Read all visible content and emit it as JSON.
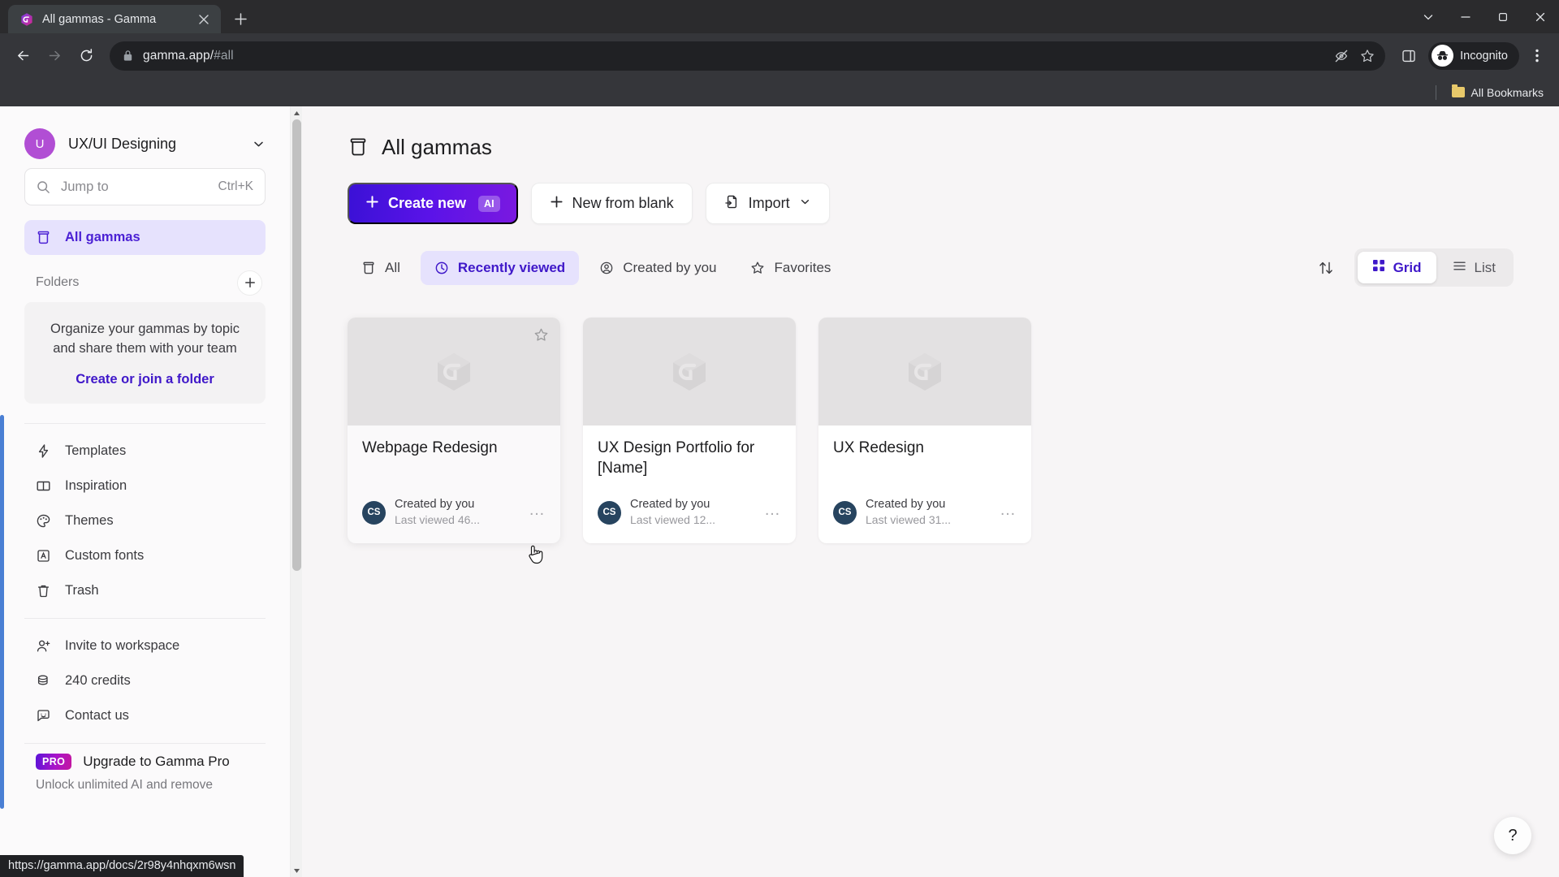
{
  "browser": {
    "tab": {
      "title": "All gammas - Gamma",
      "favicon": "gamma-logo-icon",
      "close": "×"
    },
    "newtab_label": "+",
    "window_controls": {
      "expand": "chevron-down-icon",
      "minimize": "minimize-icon",
      "maximize": "restore-icon",
      "close": "close-icon"
    },
    "nav": {
      "back": "back-arrow-icon",
      "forward": "forward-arrow-icon",
      "reload": "reload-icon"
    },
    "omnibox": {
      "lock": "lock-icon",
      "url_main": "gamma.app/",
      "url_fragment": "#all",
      "tracking": "eye-off-icon",
      "bookmark": "star-icon"
    },
    "side_panel": "side-panel-icon",
    "profile": {
      "label": "Incognito",
      "icon": "incognito-icon"
    },
    "menu": "three-dots-menu-icon",
    "bookmarks": {
      "label": "All Bookmarks",
      "icon": "folder-icon"
    },
    "status_url": "https://gamma.app/docs/2r98y4nhqxm6wsn"
  },
  "sidebar": {
    "workspace": {
      "initial": "U",
      "name": "UX/UI Designing",
      "chevron": "chevron-down-icon"
    },
    "search": {
      "placeholder": "Jump to",
      "shortcut": "Ctrl+K",
      "icon": "search-icon"
    },
    "primary_nav": [
      {
        "label": "All gammas",
        "icon": "archive-box-icon",
        "active": true
      }
    ],
    "folders": {
      "title": "Folders",
      "add_icon": "plus-icon",
      "empty_text": "Organize your gammas by topic and share them with your team",
      "cta": "Create or join a folder"
    },
    "nav": [
      {
        "label": "Templates",
        "icon": "lightning-bolt-icon"
      },
      {
        "label": "Inspiration",
        "icon": "open-book-icon"
      },
      {
        "label": "Themes",
        "icon": "palette-icon"
      },
      {
        "label": "Custom fonts",
        "icon": "font-box-icon"
      },
      {
        "label": "Trash",
        "icon": "trash-icon"
      }
    ],
    "nav2": [
      {
        "label": "Invite to workspace",
        "icon": "user-plus-icon"
      },
      {
        "label": "240 credits",
        "icon": "coins-icon"
      },
      {
        "label": "Contact us",
        "icon": "chat-smile-icon"
      }
    ],
    "pro": {
      "badge": "PRO",
      "title": "Upgrade to Gamma Pro",
      "subtitle": "Unlock unlimited AI and remove"
    }
  },
  "main": {
    "page_title": "All gammas",
    "page_title_icon": "archive-box-icon",
    "actions": [
      {
        "label": "Create new",
        "icon": "plus-icon",
        "badge": "AI",
        "variant": "primary"
      },
      {
        "label": "New from blank",
        "icon": "plus-icon",
        "variant": "white"
      },
      {
        "label": "Import",
        "icon": "import-icon",
        "chevron": "chevron-down-icon",
        "variant": "white"
      }
    ],
    "filters": [
      {
        "label": "All",
        "icon": "archive-box-icon",
        "active": false
      },
      {
        "label": "Recently viewed",
        "icon": "clock-icon",
        "active": true
      },
      {
        "label": "Created by you",
        "icon": "user-circle-icon",
        "active": false
      },
      {
        "label": "Favorites",
        "icon": "star-icon",
        "active": false
      }
    ],
    "sort_icon": "sort-arrows-icon",
    "view_modes": [
      {
        "label": "Grid",
        "icon": "grid-icon",
        "active": true
      },
      {
        "label": "List",
        "icon": "list-icon",
        "active": false
      }
    ],
    "cards": [
      {
        "title": "Webpage Redesign",
        "avatar": "CS",
        "creator": "Created by you",
        "viewed": "Last viewed 46...",
        "hovered": true,
        "starred": false
      },
      {
        "title": "UX Design Portfolio for [Name]",
        "avatar": "CS",
        "creator": "Created by you",
        "viewed": "Last viewed 12...",
        "hovered": false,
        "starred": false
      },
      {
        "title": "UX Redesign",
        "avatar": "CS",
        "creator": "Created by you",
        "viewed": "Last viewed 31...",
        "hovered": false,
        "starred": false
      }
    ],
    "help_label": "?"
  },
  "colors": {
    "accent_purple": "#3f18c9",
    "accent_light": "#e6e2fd",
    "primary_gradient_start": "#3b11d6",
    "primary_gradient_end": "#7a19e0",
    "avatar_workspace": "#b14ed4",
    "avatar_card": "#27445f",
    "page_bg": "#f7f5f6"
  }
}
